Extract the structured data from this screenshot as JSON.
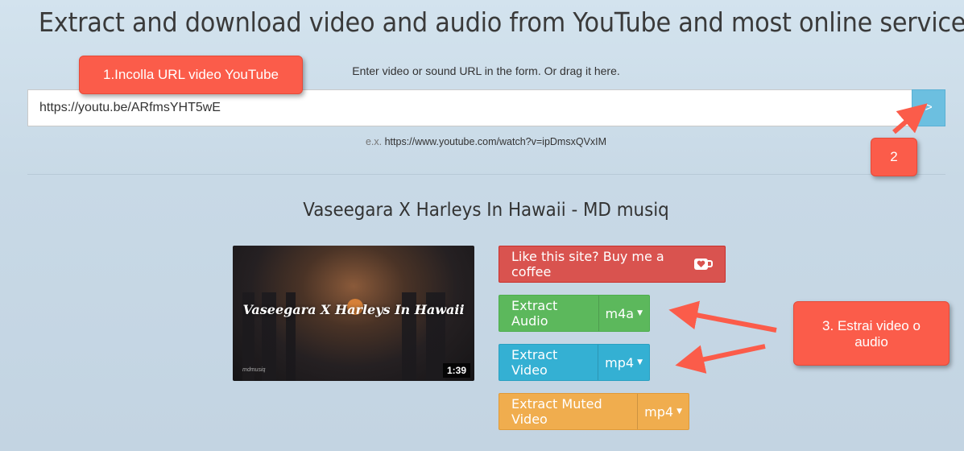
{
  "header": {
    "title": "Extract and download video and audio from YouTube and most online services"
  },
  "form": {
    "hint": "Enter video or sound URL in the form. Or drag it here.",
    "url_value": "https://youtu.be/ARfmsYHT5wE",
    "submit_label": ">",
    "example_prefix": "e.x.",
    "example_url": "https://www.youtube.com/watch?v=ipDmsxQVxIM"
  },
  "video": {
    "title": "Vaseegara X Harleys In Hawaii - MD musiq",
    "thumbnail_text": "Vaseegara X Harleys In Hawaii",
    "thumbnail_watermark": "mdmusiq",
    "duration": "1:39"
  },
  "actions": {
    "coffee_label": "Like this site? Buy me a coffee",
    "audio_label": "Extract Audio",
    "audio_format": "m4a",
    "video_label": "Extract Video",
    "video_format": "mp4",
    "muted_label": "Extract Muted Video",
    "muted_format": "mp4"
  },
  "annotations": {
    "step1": "1.Incolla URL video YouTube",
    "step2": "2",
    "step3_line1": "3. Estrai video o",
    "step3_line2": "audio"
  },
  "colors": {
    "coffee": "#d9534f",
    "audio": "#5cb85c",
    "video": "#34b0d3",
    "muted": "#f0ad4e",
    "callout": "#fb5c4a",
    "submit": "#6cbfe0"
  },
  "icons": {
    "coffee": "coffee-cup-heart-icon",
    "caret": "caret-down-icon"
  }
}
